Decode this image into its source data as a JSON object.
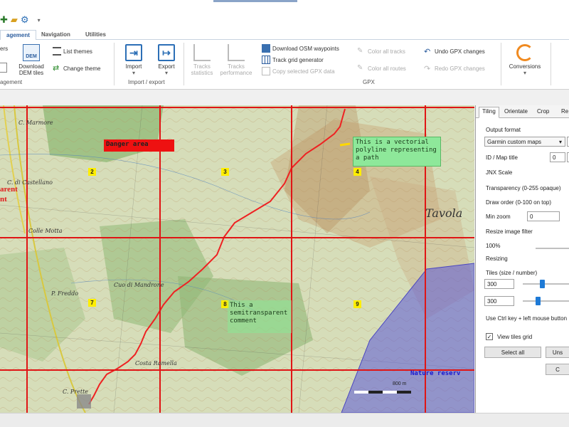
{
  "ribbon_tabs": [
    "agement",
    "Navigation",
    "Utilities"
  ],
  "ribbon": {
    "left_cut_top": "ers",
    "left_cut_bottom": "agement",
    "dem": {
      "label": "Download DEM tiles",
      "badge": "DEM"
    },
    "list_themes": "List themes",
    "change_theme": "Change theme",
    "import": "Import",
    "export": "Export",
    "import_export_group": "Import / export",
    "track_statistics": "Tracks statistics",
    "track_performance": "Tracks performance",
    "download_osm": "Download OSM waypoints",
    "track_grid": "Track grid generator",
    "copy_gpx": "Copy selected GPX data",
    "color_all_tracks": "Color all tracks",
    "color_all_routes": "Color all routes",
    "undo_gpx": "Undo GPX changes",
    "redo_gpx": "Redo GPX changes",
    "gpx_group": "GPX",
    "conversions": "Conversions"
  },
  "map": {
    "tile_numbers": [
      "2",
      "3",
      "4",
      "7",
      "8",
      "9"
    ],
    "danger_label": "Danger area",
    "polyline_comment": "This is a vectorial polyline representing a path",
    "semitransparent_comment": "This a semitransparent comment",
    "nature_reserve": "Nature reserv",
    "left_red_text_1": "arent",
    "left_red_text_2": "nt",
    "place_tavola": "Tavola",
    "place_labels": [
      "C. Marmore",
      "C. di Castellano",
      "Colle Motta",
      "P. Freddo",
      "Cuo di Mandrone",
      "Costa Ramella",
      "C. Prette"
    ],
    "scale_text": "800 m"
  },
  "panel": {
    "tabs": [
      "Tiling",
      "Orientate",
      "Crop",
      "Re"
    ],
    "output_format_label": "Output format",
    "output_format_value": "Garmin custom maps",
    "id_map_title_label": "ID / Map title",
    "id_value": "0",
    "jnx_scale_label": "JNX Scale",
    "transparency_label": "Transparency (0-255 opaque)",
    "draw_order_label": "Draw order (0-100 on top)",
    "min_zoom_label": "Min zoom",
    "min_zoom_value": "0",
    "resize_filter_label": "Resize image filter",
    "resize_percent": "100%",
    "resizing_label": "Resizing",
    "tiles_label": "Tiles (size / number)",
    "tile_w": "300",
    "tile_h": "300",
    "ctrl_hint": "Use Ctrl key + left mouse button",
    "view_tiles_grid": "View tiles grid",
    "select_all": "Select all",
    "unselect": "Uns",
    "cancel_cut": "C"
  }
}
